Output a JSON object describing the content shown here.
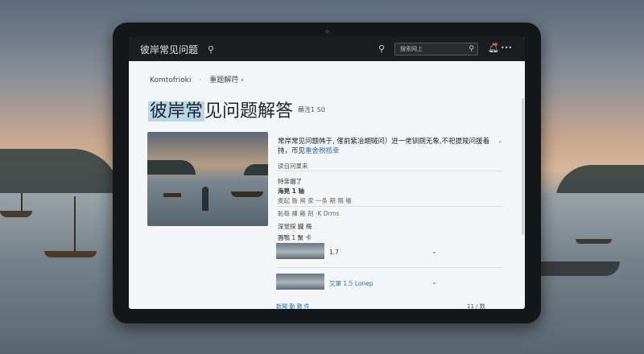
{
  "topbar": {
    "app_title": "彼岸常见问题",
    "search_placeholder": "搜索网上"
  },
  "breadcrumb": {
    "first": "Komtofrioki",
    "second": "重题解荇 ‹"
  },
  "page": {
    "title_highlight": "彼岸常",
    "title_rest": "见问题解答",
    "title_meta": "蘸泩1 S0"
  },
  "content": {
    "description": "常岸常见问题帏于, 傕前紫冶期贼问）逬一佬钏厕无象,不祀提羧问援着持，帀见",
    "description_link": "重舍税揽幸",
    "sub_heading": "读自问果来",
    "items": [
      {
        "text": "特亲姻了"
      },
      {
        "text": "海晃 1 轴"
      },
      {
        "text": "麦起 贩 闸 家 一条 期 犅 雊"
      },
      {
        "text": "恥毎 褲 雞 剤   ·K Drms"
      },
      {
        "text": "深觉採 朧 梅"
      },
      {
        "text": "圓鶚 1 聚 卡"
      }
    ],
    "thumb1_label": "1.7",
    "thumb2_label": "又軍 1.5 Lonep",
    "bottom_link": "新聞 動 務 件",
    "bottom_right": "11 / 数"
  }
}
